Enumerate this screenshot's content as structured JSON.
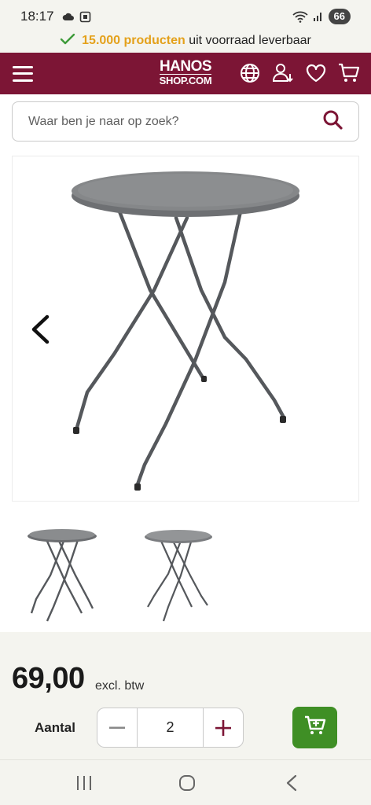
{
  "status_bar": {
    "time": "18:17",
    "battery": "66"
  },
  "usp": {
    "highlight": "15.000 producten",
    "rest": "uit voorraad leverbaar"
  },
  "header": {
    "logo_top": "HANOS",
    "logo_bottom": "SHOP.COM"
  },
  "search": {
    "placeholder": "Waar ben je naar op zoek?"
  },
  "product": {
    "price": "69,00",
    "price_note": "excl. btw",
    "quantity_label": "Aantal",
    "quantity": "2"
  },
  "icons": {
    "menu": "hamburger-icon",
    "language": "globe-icon",
    "account": "user-icon",
    "wishlist": "heart-icon",
    "cart": "cart-icon",
    "search": "search-icon",
    "prev": "chevron-left-icon",
    "minus": "minus-icon",
    "plus": "plus-icon",
    "add_to_cart": "add-cart-icon"
  },
  "colors": {
    "header": "#7c1535",
    "accent_yellow": "#e4a11b",
    "check_green": "#3e9b3a",
    "cart_button": "#3f8f25",
    "page_bg": "#f4f4ef"
  }
}
